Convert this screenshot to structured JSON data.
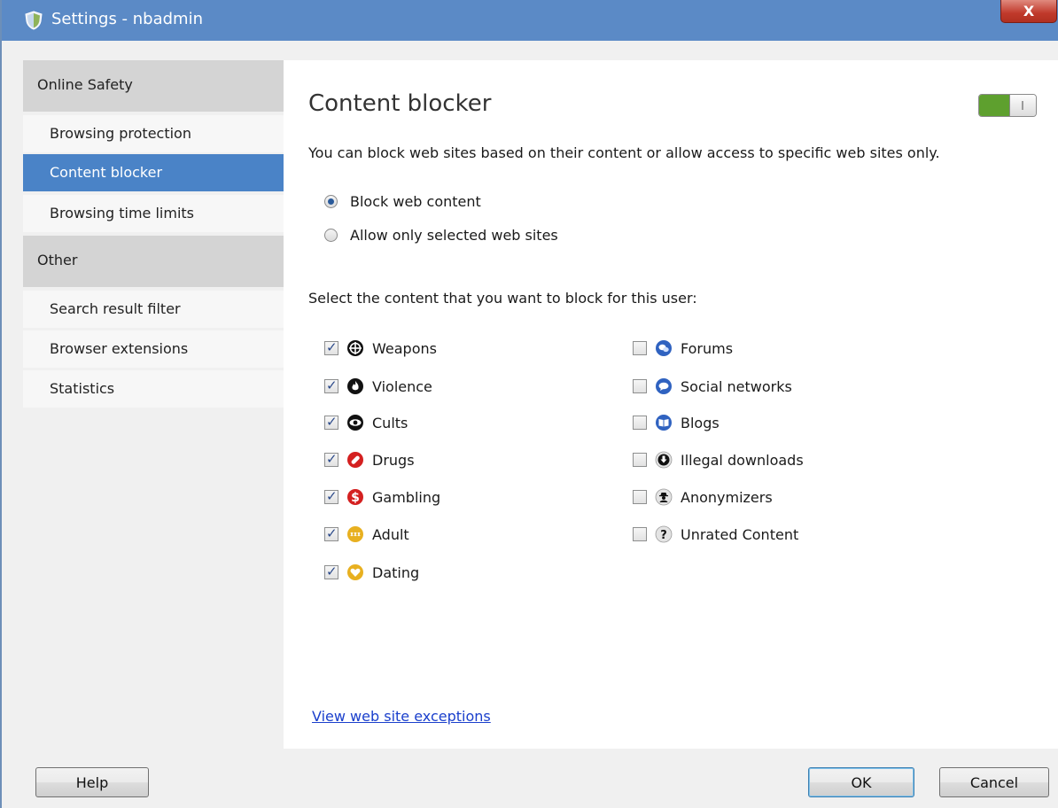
{
  "window": {
    "title": "Settings - nbadmin",
    "close_label": "X"
  },
  "sidebar": {
    "sections": [
      {
        "header": "Online Safety",
        "items": [
          "Browsing protection",
          "Content blocker",
          "Browsing time limits"
        ]
      },
      {
        "header": "Other",
        "items": [
          "Search result filter",
          "Browser extensions",
          "Statistics"
        ]
      }
    ],
    "active_item": "Content blocker"
  },
  "main": {
    "heading": "Content blocker",
    "toggle_state": "on",
    "description": "You can block web sites based on their content or allow access to specific web sites only.",
    "radio_options": [
      {
        "label": "Block web content",
        "checked": true
      },
      {
        "label": "Allow only selected web sites",
        "checked": false
      }
    ],
    "select_label": "Select the content that you want to block for this user:",
    "categories_left": [
      {
        "label": "Weapons",
        "checked": true,
        "icon": "crosshair-icon"
      },
      {
        "label": "Violence",
        "checked": true,
        "icon": "fire-icon"
      },
      {
        "label": "Cults",
        "checked": true,
        "icon": "eye-icon"
      },
      {
        "label": "Drugs",
        "checked": true,
        "icon": "pill-icon"
      },
      {
        "label": "Gambling",
        "checked": true,
        "icon": "dollar-icon"
      },
      {
        "label": "Adult",
        "checked": true,
        "icon": "xxx-icon"
      },
      {
        "label": "Dating",
        "checked": true,
        "icon": "heart-icon"
      }
    ],
    "categories_right": [
      {
        "label": "Forums",
        "checked": false,
        "icon": "chat-bubbles-icon"
      },
      {
        "label": "Social networks",
        "checked": false,
        "icon": "speech-bubble-icon"
      },
      {
        "label": "Blogs",
        "checked": false,
        "icon": "book-icon"
      },
      {
        "label": "Illegal downloads",
        "checked": false,
        "icon": "download-arrow-icon"
      },
      {
        "label": "Anonymizers",
        "checked": false,
        "icon": "spy-icon"
      },
      {
        "label": "Unrated Content",
        "checked": false,
        "icon": "question-icon"
      }
    ],
    "exceptions_link": "View web site exceptions"
  },
  "buttons": {
    "help": "Help",
    "ok": "OK",
    "cancel": "Cancel"
  },
  "colors": {
    "titlebar": "#5b8ac6",
    "active_item": "#4a83c7",
    "toggle_on": "#5ea02e",
    "link": "#1a3fcc"
  }
}
